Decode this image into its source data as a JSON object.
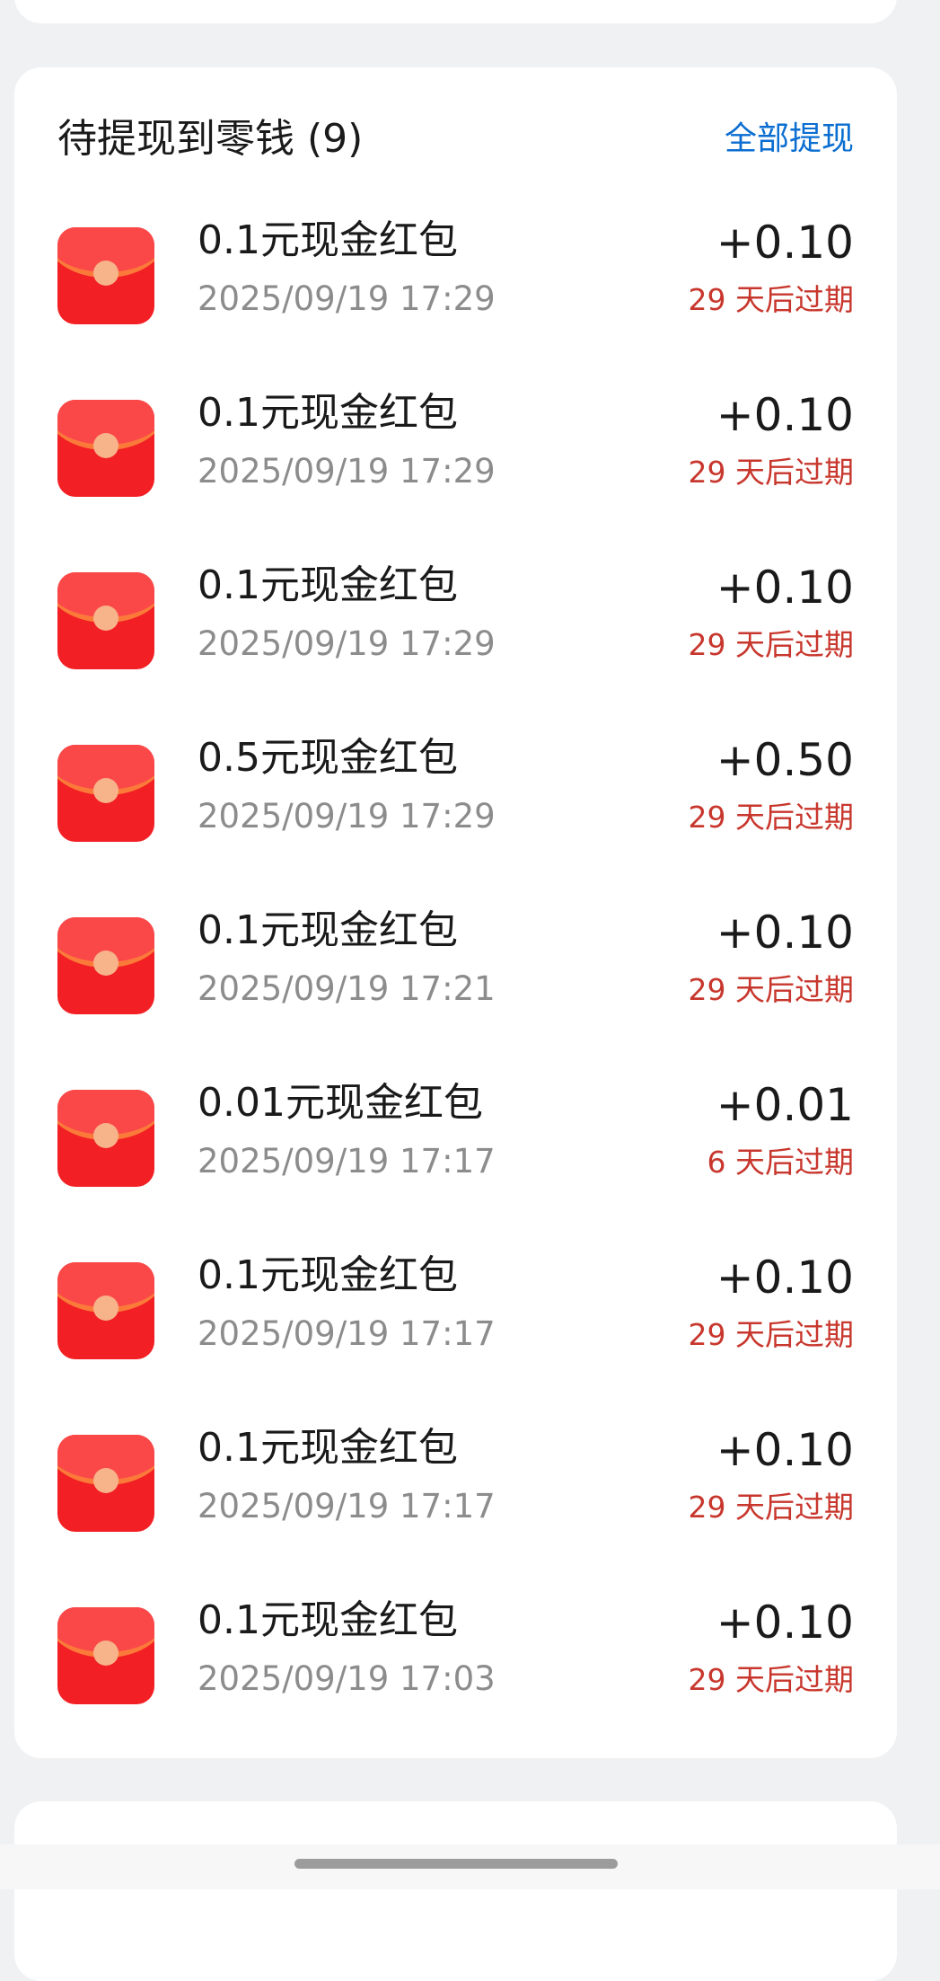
{
  "card": {
    "title": "待提现到零钱 (9)",
    "action_label": "全部提现"
  },
  "items": [
    {
      "title": "0.1元现金红包",
      "time": "2025/09/19 17:29",
      "amount": "+0.10",
      "expiry": "29 天后过期",
      "icon": "red-envelope-icon"
    },
    {
      "title": "0.1元现金红包",
      "time": "2025/09/19 17:29",
      "amount": "+0.10",
      "expiry": "29 天后过期",
      "icon": "red-envelope-icon"
    },
    {
      "title": "0.1元现金红包",
      "time": "2025/09/19 17:29",
      "amount": "+0.10",
      "expiry": "29 天后过期",
      "icon": "red-envelope-icon"
    },
    {
      "title": "0.5元现金红包",
      "time": "2025/09/19 17:29",
      "amount": "+0.50",
      "expiry": "29 天后过期",
      "icon": "red-envelope-icon"
    },
    {
      "title": "0.1元现金红包",
      "time": "2025/09/19 17:21",
      "amount": "+0.10",
      "expiry": "29 天后过期",
      "icon": "red-envelope-icon"
    },
    {
      "title": "0.01元现金红包",
      "time": "2025/09/19 17:17",
      "amount": "+0.01",
      "expiry": "6 天后过期",
      "icon": "red-envelope-icon"
    },
    {
      "title": "0.1元现金红包",
      "time": "2025/09/19 17:17",
      "amount": "+0.10",
      "expiry": "29 天后过期",
      "icon": "red-envelope-icon"
    },
    {
      "title": "0.1元现金红包",
      "time": "2025/09/19 17:17",
      "amount": "+0.10",
      "expiry": "29 天后过期",
      "icon": "red-envelope-icon"
    },
    {
      "title": "0.1元现金红包",
      "time": "2025/09/19 17:03",
      "amount": "+0.10",
      "expiry": "29 天后过期",
      "icon": "red-envelope-icon"
    }
  ],
  "colors": {
    "background": "#f0f1f3",
    "card": "#ffffff",
    "action_blue": "#0a6ed1",
    "expiry_red": "#c8372d",
    "envelope_red": "#f21f24"
  }
}
